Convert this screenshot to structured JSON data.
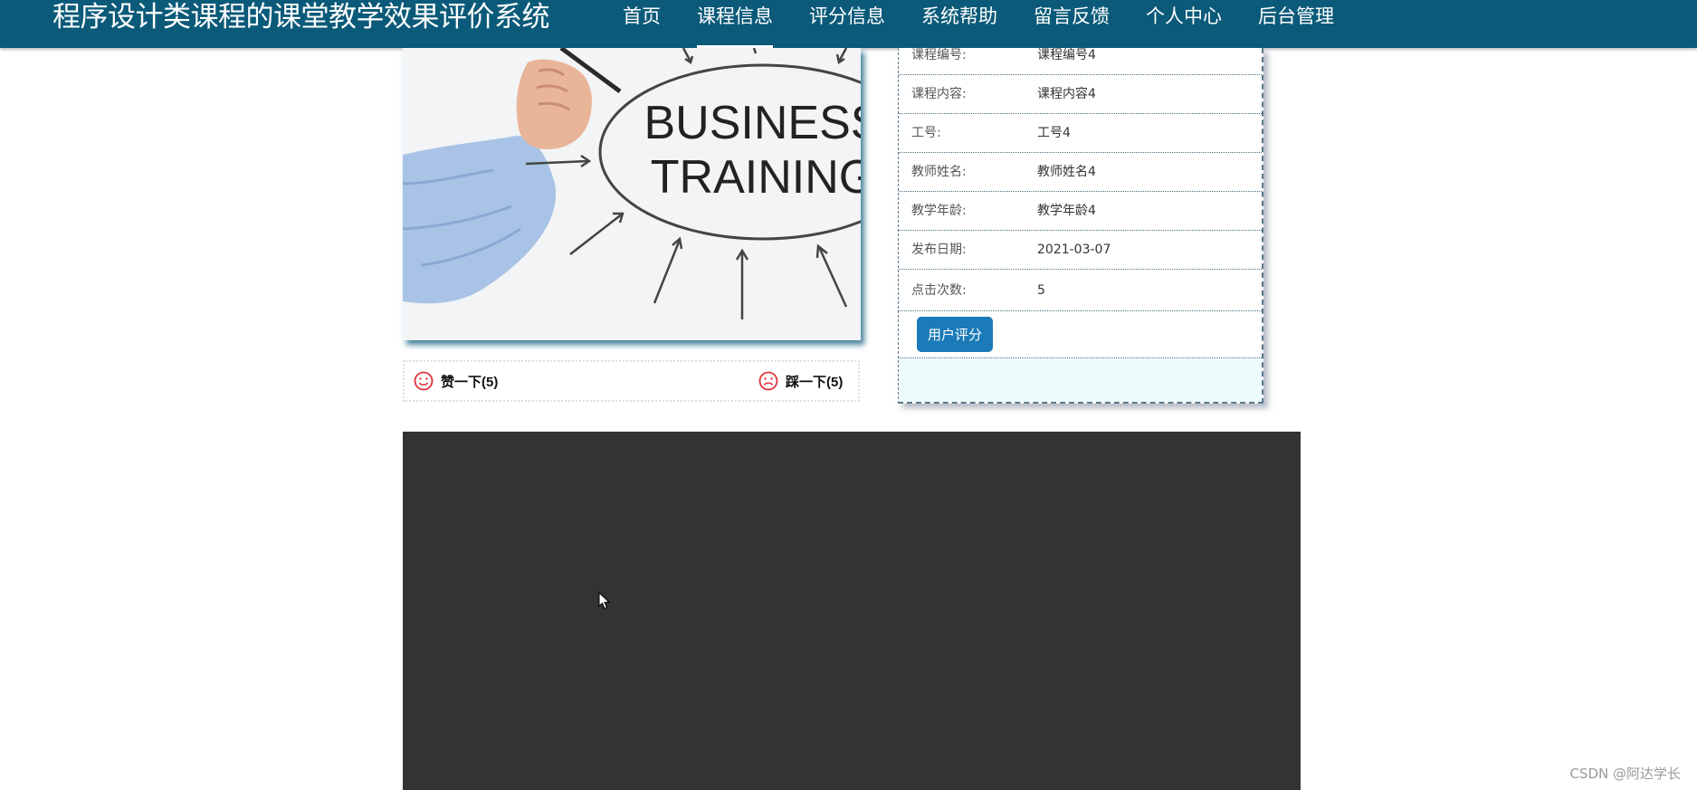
{
  "header": {
    "site_title": "程序设计类课程的课堂教学效果评价系统",
    "nav": [
      {
        "label": "首页"
      },
      {
        "label": "课程信息"
      },
      {
        "label": "评分信息"
      },
      {
        "label": "系统帮助"
      },
      {
        "label": "留言反馈"
      },
      {
        "label": "个人中心"
      },
      {
        "label": "后台管理"
      }
    ],
    "active_nav": "课程信息"
  },
  "photo": {
    "text_line1": "BUSINESS",
    "text_line2": "TRAINING"
  },
  "votes": {
    "like_label": "赞一下(5)",
    "dislike_label": "踩一下(5)"
  },
  "detail": {
    "rows": [
      {
        "key": "课程编号:",
        "value": "课程编号4"
      },
      {
        "key": "课程内容:",
        "value": "课程内容4"
      },
      {
        "key": "工号:",
        "value": "工号4"
      },
      {
        "key": "教师姓名:",
        "value": "教师姓名4"
      },
      {
        "key": "教学年龄:",
        "value": "教学年龄4"
      },
      {
        "key": "发布日期:",
        "value": "2021-03-07"
      },
      {
        "key": "点击次数:",
        "value": "5"
      }
    ],
    "rate_button": "用户评分"
  },
  "watermark": "CSDN @阿达学长",
  "colors": {
    "nav_bg": "#0b5a79",
    "button_bg": "#1b7bb8",
    "player_bg": "#333333",
    "vote_icon": "#e0333a"
  }
}
